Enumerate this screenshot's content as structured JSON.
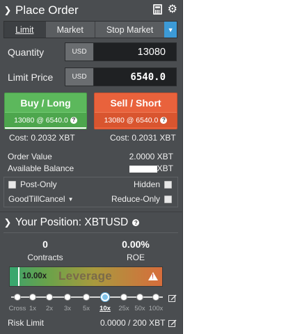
{
  "order": {
    "title": "Place Order",
    "tabs": [
      "Limit",
      "Market",
      "Stop Market"
    ],
    "active_tab": "Limit",
    "quantity": {
      "label": "Quantity",
      "currency": "USD",
      "value": "13080"
    },
    "limit_price": {
      "label": "Limit Price",
      "currency": "USD",
      "value": "6540.0"
    },
    "buy": {
      "label": "Buy / Long",
      "detail": "13080 @ 6540.0",
      "cost": "Cost: 0.2032 XBT"
    },
    "sell": {
      "label": "Sell / Short",
      "detail": "13080 @ 6540.0",
      "cost": "Cost: 0.2031 XBT"
    },
    "order_value": {
      "label": "Order Value",
      "value": "2.0000 XBT"
    },
    "available_balance": {
      "label": "Available Balance",
      "value": "XBT"
    },
    "options": {
      "post_only": "Post-Only",
      "hidden": "Hidden",
      "time_in_force": "GoodTillCancel",
      "reduce_only": "Reduce-Only"
    }
  },
  "position": {
    "title": "Your Position: XBTUSD",
    "contracts": {
      "value": "0",
      "label": "Contracts"
    },
    "roe": {
      "value": "0.00%",
      "label": "ROE"
    },
    "leverage": {
      "value_label": "10.00x",
      "label": "Leverage",
      "value": 10,
      "steps": [
        "Cross",
        "1x",
        "2x",
        "3x",
        "5x",
        "10x",
        "25x",
        "50x",
        "100x"
      ],
      "selected_index": 5
    },
    "risk_limit": {
      "label": "Risk Limit",
      "value": "0.0000 / 200 XBT"
    }
  },
  "colors": {
    "panel": "#4a4d50",
    "buy": "#5cb85c",
    "sell": "#e9623c",
    "dropdown_accent": "#3c9ad6"
  },
  "icons": [
    "chevron-down-icon",
    "calculator-icon",
    "gear-icon",
    "help-icon",
    "warning-icon",
    "edit-icon",
    "checkbox-icon"
  ]
}
